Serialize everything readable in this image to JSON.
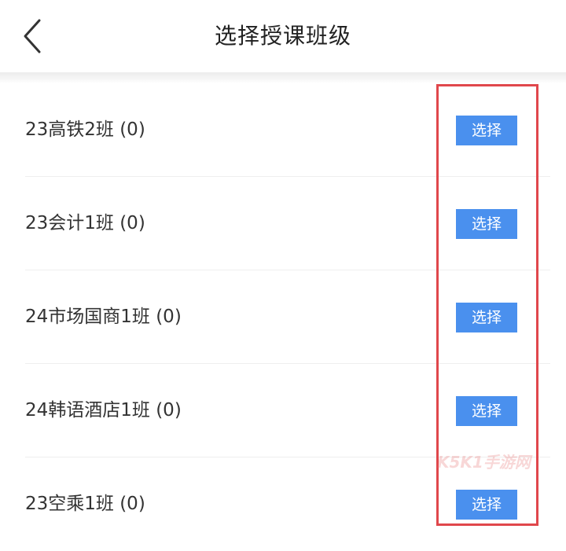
{
  "header": {
    "title": "选择授课班级",
    "back_icon": "chevron-left-icon"
  },
  "classes": [
    {
      "label": "23高铁2班 (0)",
      "button": "选择"
    },
    {
      "label": "23会计1班 (0)",
      "button": "选择"
    },
    {
      "label": "24市场国商1班 (0)",
      "button": "选择"
    },
    {
      "label": "24韩语酒店1班 (0)",
      "button": "选择"
    },
    {
      "label": "23空乘1班 (0)",
      "button": "选择"
    }
  ],
  "watermark": "K5K1手游网",
  "colors": {
    "button_bg": "#4a90ee",
    "highlight_border": "#e0474c",
    "text": "#333333"
  }
}
